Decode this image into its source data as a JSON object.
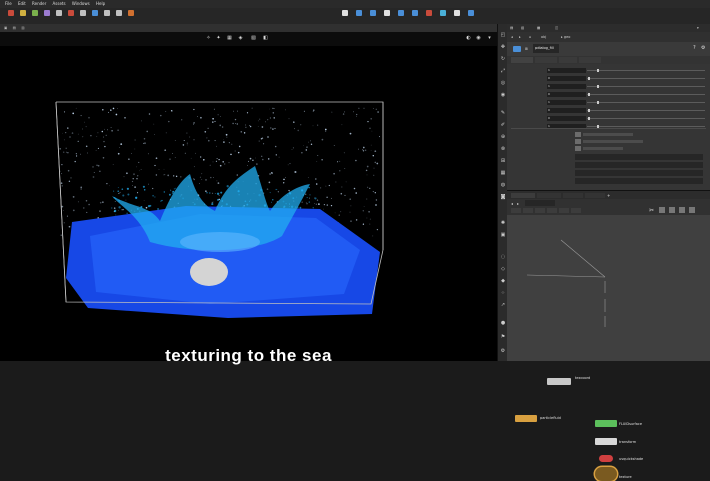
{
  "menubar": {
    "items": [
      "File",
      "Edit",
      "Render",
      "Assets",
      "Windows",
      "Help"
    ]
  },
  "shelf": {
    "left_tools": [
      {
        "icon": "shelf-tool-icon",
        "color": "#c94b3b"
      },
      {
        "icon": "shelf-tool-icon",
        "color": "#d0b040"
      },
      {
        "icon": "shelf-tool-icon",
        "color": "#7ab04c"
      },
      {
        "icon": "shelf-tool-icon",
        "color": "#9b7bd0"
      },
      {
        "icon": "shelf-tool-icon",
        "color": "#c0c0c0"
      },
      {
        "icon": "shelf-tool-icon",
        "color": "#c94b3b"
      },
      {
        "icon": "shelf-tool-icon",
        "color": "#c0c0c0"
      },
      {
        "icon": "shelf-tool-icon",
        "color": "#4a8fd8"
      },
      {
        "icon": "shelf-tool-icon",
        "color": "#c0c0c0"
      },
      {
        "icon": "shelf-tool-icon",
        "color": "#c0c0c0"
      },
      {
        "icon": "shelf-tool-icon",
        "color": "#d07030"
      }
    ],
    "right_tools": [
      {
        "icon": "shelf-tool-icon",
        "color": "#e0e0e0"
      },
      {
        "icon": "shelf-tool-icon",
        "color": "#4a8fd8"
      },
      {
        "icon": "shelf-tool-icon",
        "color": "#4a8fd8"
      },
      {
        "icon": "shelf-tool-icon",
        "color": "#e0e0e0"
      },
      {
        "icon": "shelf-tool-icon",
        "color": "#4a8fd8"
      },
      {
        "icon": "shelf-tool-icon",
        "color": "#4a8fd8"
      },
      {
        "icon": "shelf-tool-icon",
        "color": "#c94b3b"
      },
      {
        "icon": "shelf-tool-icon",
        "color": "#4ab0d8"
      },
      {
        "icon": "shelf-tool-icon",
        "color": "#e0e0e0"
      },
      {
        "icon": "shelf-tool-icon",
        "color": "#4a8fd8"
      }
    ]
  },
  "viewport": {
    "particles_color": "#cfe6ff",
    "water_color": "#1748e6",
    "splash_color": "#22aef0",
    "box_color": "#bfbfbf",
    "sphere_color": "#d4d4d4"
  },
  "parameters": {
    "node_name": "pdialog_fill",
    "rows": [
      {
        "value": "1"
      },
      {
        "value": "0"
      },
      {
        "value": "1"
      },
      {
        "value": "0"
      },
      {
        "value": "1"
      },
      {
        "value": "0"
      },
      {
        "value": "0"
      },
      {
        "value": "1"
      }
    ]
  },
  "network": {
    "nodes": [
      {
        "name": "texcoord",
        "color": "#c8c8c8"
      },
      {
        "name": "particlefluid",
        "color": "#d8a040"
      },
      {
        "name": "FLUIDsurface",
        "color": "#5cc05c"
      },
      {
        "name": "transform",
        "color": "#d8d8d8"
      },
      {
        "name": "uvquickshade",
        "color": "#d04040"
      },
      {
        "name": "texture",
        "color": "#d8a040"
      }
    ]
  },
  "subtitle": "texturing to the sea"
}
